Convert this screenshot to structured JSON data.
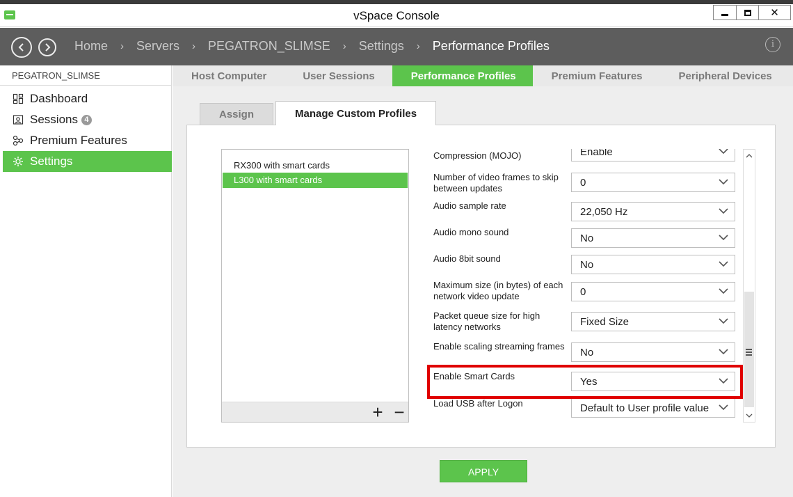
{
  "window": {
    "title": "vSpace Console"
  },
  "breadcrumb": [
    "Home",
    "Servers",
    "PEGATRON_SLIMSE",
    "Settings",
    "Performance Profiles"
  ],
  "breadcrumb_separator": "›",
  "sidebar": {
    "server": "PEGATRON_SLIMSE",
    "items": [
      {
        "label": "Dashboard",
        "icon": "dashboard-icon"
      },
      {
        "label": "Sessions",
        "icon": "sessions-icon",
        "badge": "4"
      },
      {
        "label": "Premium Features",
        "icon": "premium-features-icon"
      },
      {
        "label": "Settings",
        "icon": "settings-icon",
        "active": true
      }
    ]
  },
  "tabs": [
    {
      "label": "Host Computer"
    },
    {
      "label": "User Sessions"
    },
    {
      "label": "Performance Profiles",
      "active": true
    },
    {
      "label": "Premium Features"
    },
    {
      "label": "Peripheral Devices"
    }
  ],
  "subtabs": [
    {
      "label": "Assign"
    },
    {
      "label": "Manage Custom Profiles",
      "active": true
    }
  ],
  "profiles": {
    "items": [
      "RX300 with smart cards",
      "L300 with smart cards"
    ],
    "selected_index": 1,
    "add_label": "+",
    "remove_label": "−"
  },
  "settings": [
    {
      "label": "Compression (MOJO)",
      "value": "Enable"
    },
    {
      "label": "Number of video frames to skip between updates",
      "value": "0"
    },
    {
      "label": "Audio sample rate",
      "value": "22,050 Hz"
    },
    {
      "label": "Audio mono sound",
      "value": "No"
    },
    {
      "label": "Audio 8bit sound",
      "value": "No"
    },
    {
      "label": "Maximum size (in bytes) of each network video update",
      "value": "0"
    },
    {
      "label": "Packet queue size for high latency networks",
      "value": "Fixed Size"
    },
    {
      "label": "Enable scaling streaming frames",
      "value": "No"
    },
    {
      "label": "Enable Smart Cards",
      "value": "Yes",
      "highlighted": true
    },
    {
      "label": "Load USB after Logon",
      "value": "Default to User profile value"
    }
  ],
  "apply_label": "APPLY",
  "colors": {
    "accent": "#5cc44c",
    "nav_bg": "#5d5d5d",
    "highlight": "#e00000"
  }
}
